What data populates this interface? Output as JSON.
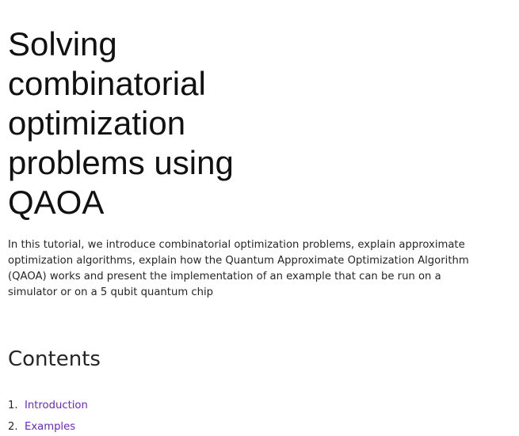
{
  "document": {
    "title": "Solving combinatorial optimization problems using QAOA",
    "intro": "In this tutorial, we introduce combinatorial optimization problems, explain approximate optimization algorithms, explain how the Quantum Approximate Optimization Algorithm (QAOA) works and present the implementation of an example that can be run on a simulator or on a 5 qubit quantum chip",
    "contents_heading": "Contents",
    "toc": [
      {
        "number": "1.",
        "label": "Introduction"
      },
      {
        "number": "2.",
        "label": "Examples"
      }
    ],
    "link_color": "#6929c4"
  }
}
